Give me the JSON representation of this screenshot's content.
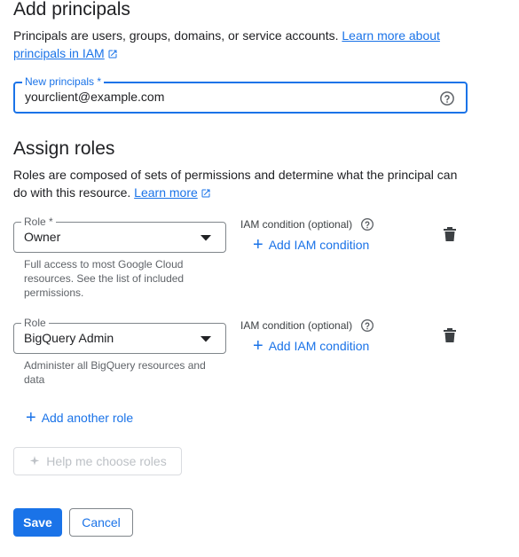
{
  "section_principals": {
    "title": "Add principals",
    "desc_text": "Principals are users, groups, domains, or service accounts. ",
    "learn_more_line1": "Learn more about",
    "learn_more_line2": "principals in IAM",
    "field_label": "New principals *",
    "field_value": "yourclient@example.com"
  },
  "section_roles": {
    "title": "Assign roles",
    "desc_line1": "Roles are composed of sets of permissions and determine what the principal can",
    "desc_line2": "do with this resource. ",
    "learn_more": "Learn more"
  },
  "roles": [
    {
      "label": "Role *",
      "value": "Owner",
      "help": [
        "Full access to most Google Cloud",
        "resources. See the list of included",
        "permissions."
      ],
      "condition_label": "IAM condition (optional)",
      "add_condition": "Add IAM condition"
    },
    {
      "label": "Role",
      "value": "BigQuery Admin",
      "help": [
        "Administer all BigQuery resources and",
        "data"
      ],
      "condition_label": "IAM condition (optional)",
      "add_condition": "Add IAM condition"
    }
  ],
  "add_another_role": "Add another role",
  "help_me_choose": "Help me choose roles",
  "buttons": {
    "save": "Save",
    "cancel": "Cancel"
  },
  "colors": {
    "accent": "#1a73e8",
    "text": "#202124",
    "muted": "#5f6368",
    "disabled": "#bdc1c6"
  }
}
